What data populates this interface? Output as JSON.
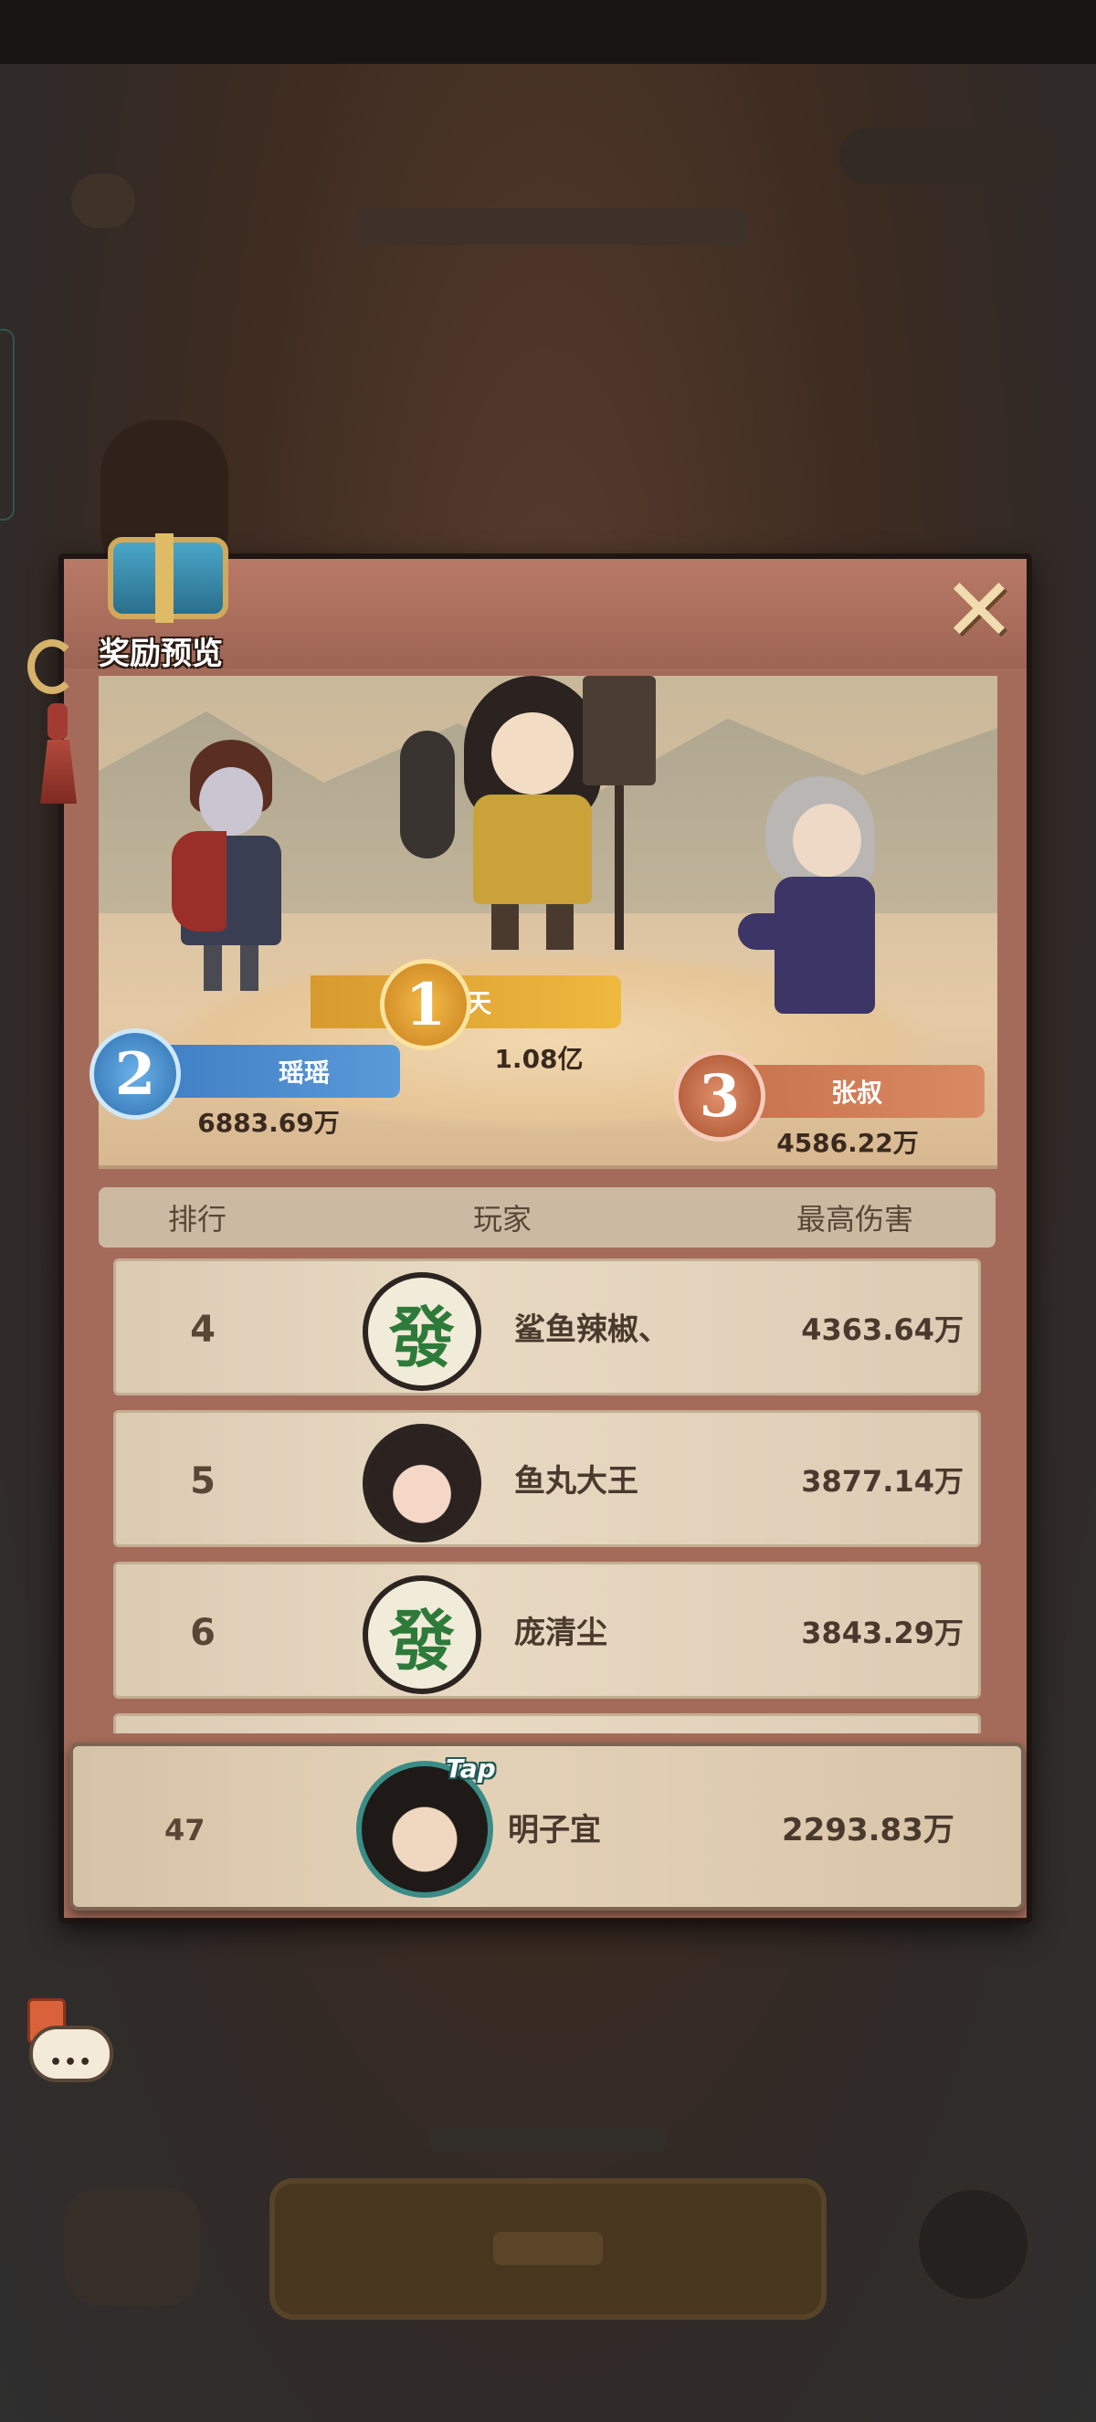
{
  "reward_preview": {
    "label": "奖励预览"
  },
  "close_label": "✕",
  "podium": [
    {
      "rank": "1",
      "name": "景天",
      "score": "1.08亿"
    },
    {
      "rank": "2",
      "name": "瑶瑶",
      "score": "6883.69万"
    },
    {
      "rank": "3",
      "name": "张叔",
      "score": "4586.22万"
    }
  ],
  "table": {
    "col_rank": "排行",
    "col_player": "玩家",
    "col_damage": "最高伤害"
  },
  "rows": [
    {
      "rank": "4",
      "avatar_text": "發",
      "name": "鲨鱼辣椒、",
      "score": "4363.64万"
    },
    {
      "rank": "5",
      "avatar_text": "",
      "name": "鱼丸大王",
      "score": "3877.14万"
    },
    {
      "rank": "6",
      "avatar_text": "發",
      "name": "庞清尘",
      "score": "3843.29万"
    }
  ],
  "self": {
    "rank": "47",
    "tag": "Tap",
    "name": "明子宜",
    "score": "2293.83万"
  },
  "chat": {
    "dots": "•••"
  }
}
